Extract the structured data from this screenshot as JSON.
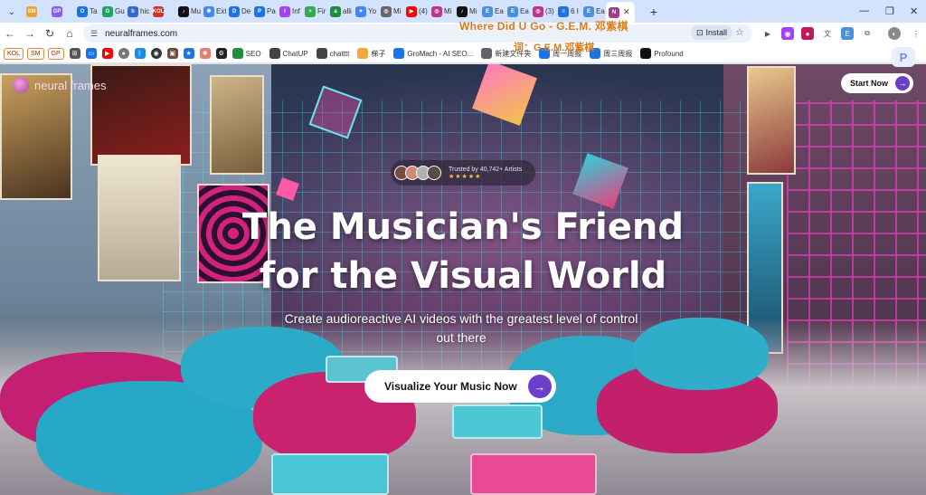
{
  "browser": {
    "tabs": [
      {
        "label": "",
        "icon": "SM",
        "color": "#f0a030"
      },
      {
        "label": "",
        "icon": "GP",
        "color": "#8a5cf6"
      },
      {
        "label": "Ta",
        "icon": "O",
        "color": "#1a73e8"
      },
      {
        "label": "Gu",
        "icon": "G",
        "color": "#21a366"
      },
      {
        "label": "hic",
        "icon": "b",
        "color": "#3367d6"
      },
      {
        "label": "",
        "icon": "KOL",
        "color": "#d93025"
      },
      {
        "label": "Mu",
        "icon": "♪",
        "color": "#111111"
      },
      {
        "label": "Ext",
        "icon": "✱",
        "color": "#4285f4"
      },
      {
        "label": "De",
        "icon": "D",
        "color": "#1a73e8"
      },
      {
        "label": "Pa",
        "icon": "P",
        "color": "#1a73e8"
      },
      {
        "label": "Inf",
        "icon": "I",
        "color": "#a142f4"
      },
      {
        "label": "Fir",
        "icon": "+",
        "color": "#34a853"
      },
      {
        "label": "alli",
        "icon": "a",
        "color": "#1e8e3e"
      },
      {
        "label": "Yo",
        "icon": "✦",
        "color": "#4285f4"
      },
      {
        "label": "Mi",
        "icon": "◎",
        "color": "#666666"
      },
      {
        "label": "(4)",
        "icon": "▶",
        "color": "#ff0000"
      },
      {
        "label": "Mi",
        "icon": "◎",
        "color": "#c13584"
      },
      {
        "label": "Mi",
        "icon": "♪",
        "color": "#111111"
      },
      {
        "label": "Ea",
        "icon": "E",
        "color": "#4a90e2"
      },
      {
        "label": "Ea",
        "icon": "E",
        "color": "#4a90e2"
      },
      {
        "label": "(3)",
        "icon": "◎",
        "color": "#c13584"
      },
      {
        "label": "6 I",
        "icon": "≡",
        "color": "#1a73e8"
      },
      {
        "label": "Ea",
        "icon": "E",
        "color": "#4a90e2"
      },
      {
        "label": "",
        "icon": "N",
        "color": "#a03c8a",
        "active": true
      }
    ],
    "lyrics_line1": "Where Did U Go - G.E.M. 邓紫棋",
    "lyrics_line2": "词：G.E.M.邓紫棋",
    "url": "neuralframes.com",
    "install_label": "Install",
    "bookmarks": [
      {
        "label": "KOL",
        "type": "chip"
      },
      {
        "label": "SM",
        "type": "chip"
      },
      {
        "label": "GP",
        "type": "chip"
      },
      {
        "label": "SEO",
        "icon_color": "#1e8e3e"
      },
      {
        "label": "ChatUP",
        "icon_color": "#444444"
      },
      {
        "label": "chatttt",
        "icon_color": "#444444"
      },
      {
        "label": "梯子",
        "icon_color": "#f2a93b"
      },
      {
        "label": "GroMach - AI SEO...",
        "icon_color": "#1a73e8"
      },
      {
        "label": "新建文件夹",
        "icon_color": "#5f6368"
      },
      {
        "label": "周一周报",
        "icon_color": "#1a73e8"
      },
      {
        "label": "周三周报",
        "icon_color": "#1a73e8"
      },
      {
        "label": "Profound",
        "icon_color": "#111111"
      }
    ]
  },
  "site": {
    "brand_name": "neural frames",
    "start_label": "Start Now",
    "trust_label": "Trusted by 40,742+ Artists",
    "stars": "★★★★★",
    "headline_line1": "The Musician's Friend",
    "headline_line2": "for the Visual World",
    "subhead": "Create audioreactive AI videos with the greatest level of control out there",
    "cta_label": "Visualize Your Music Now",
    "accent": "#6b3fc9"
  }
}
